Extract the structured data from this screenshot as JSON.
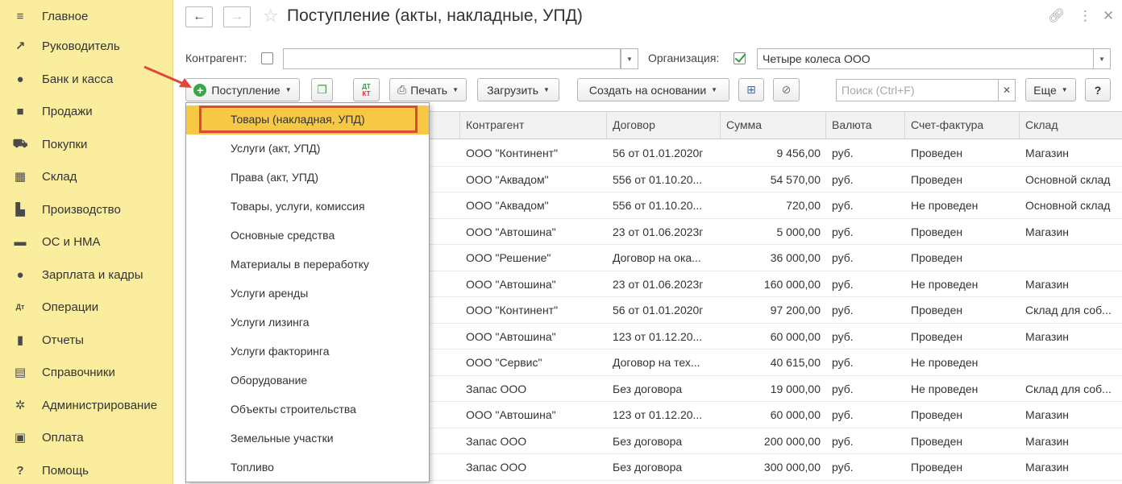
{
  "sidebar": {
    "items": [
      {
        "label": "Главное",
        "icon": "menu-icon"
      },
      {
        "label": "Руководитель",
        "icon": "trend-icon"
      },
      {
        "label": "Банк и касса",
        "icon": "coin-icon"
      },
      {
        "label": "Продажи",
        "icon": "bag-icon"
      },
      {
        "label": "Покупки",
        "icon": "cart-icon"
      },
      {
        "label": "Склад",
        "icon": "warehouse-icon"
      },
      {
        "label": "Производство",
        "icon": "factory-icon"
      },
      {
        "label": "ОС и НМА",
        "icon": "truck-icon"
      },
      {
        "label": "Зарплата и кадры",
        "icon": "person-icon"
      },
      {
        "label": "Операции",
        "icon": "dt-kt-icon"
      },
      {
        "label": "Отчеты",
        "icon": "bar-chart-icon"
      },
      {
        "label": "Справочники",
        "icon": "books-icon"
      },
      {
        "label": "Администрирование",
        "icon": "gear-icon"
      },
      {
        "label": "Оплата",
        "icon": "wallet-icon"
      },
      {
        "label": "Помощь",
        "icon": "question-icon"
      }
    ]
  },
  "header": {
    "title": "Поступление (акты, накладные, УПД)"
  },
  "filters": {
    "counterparty_label": "Контрагент:",
    "counterparty_value": "",
    "organization_label": "Организация:",
    "organization_value": "Четыре колеса ООО"
  },
  "toolbar": {
    "receipt_label": "Поступление",
    "print_label": "Печать",
    "load_label": "Загрузить",
    "create_based_label": "Создать на основании",
    "search_placeholder": "Поиск (Ctrl+F)",
    "more_label": "Еще",
    "help_label": "?",
    "dtkt_top": "ДТ",
    "dtkt_bottom": "КТ"
  },
  "menu": {
    "items": [
      "Товары (накладная, УПД)",
      "Услуги (акт, УПД)",
      "Права (акт, УПД)",
      "Товары, услуги, комиссия",
      "Основные средства",
      "Материалы в переработку",
      "Услуги аренды",
      "Услуги лизинга",
      "Услуги факторинга",
      "Оборудование",
      "Объекты строительства",
      "Земельные участки",
      "Топливо"
    ],
    "selected_index": 0
  },
  "table": {
    "columns": [
      "Контрагент",
      "Договор",
      "Сумма",
      "Валюта",
      "Счет-фактура",
      "Склад"
    ],
    "rows": [
      [
        "ООО \"Континент\"",
        "56 от 01.01.2020г",
        "9 456,00",
        "руб.",
        "Проведен",
        "Магазин"
      ],
      [
        "ООО \"Аквадом\"",
        "556 от 01.10.20...",
        "54 570,00",
        "руб.",
        "Проведен",
        "Основной склад"
      ],
      [
        "ООО \"Аквадом\"",
        "556 от 01.10.20...",
        "720,00",
        "руб.",
        "Не проведен",
        "Основной склад"
      ],
      [
        "ООО \"Автошина\"",
        "23 от 01.06.2023г",
        "5 000,00",
        "руб.",
        "Проведен",
        "Магазин"
      ],
      [
        "ООО \"Решение\"",
        "Договор на ока...",
        "36 000,00",
        "руб.",
        "Проведен",
        ""
      ],
      [
        "ООО \"Автошина\"",
        "23 от 01.06.2023г",
        "160 000,00",
        "руб.",
        "Не проведен",
        "Магазин"
      ],
      [
        "ООО \"Континент\"",
        "56 от 01.01.2020г",
        "97 200,00",
        "руб.",
        "Проведен",
        "Склад для соб..."
      ],
      [
        "ООО \"Автошина\"",
        "123 от 01.12.20...",
        "60 000,00",
        "руб.",
        "Проведен",
        "Магазин"
      ],
      [
        "ООО \"Сервис\"",
        "Договор на тех...",
        "40 615,00",
        "руб.",
        "Не проведен",
        ""
      ],
      [
        "Запас ООО",
        "Без договора",
        "19 000,00",
        "руб.",
        "Не проведен",
        "Склад для соб..."
      ],
      [
        "ООО \"Автошина\"",
        "123 от 01.12.20...",
        "60 000,00",
        "руб.",
        "Проведен",
        "Магазин"
      ],
      [
        "Запас ООО",
        "Без договора",
        "200 000,00",
        "руб.",
        "Проведен",
        "Магазин"
      ],
      [
        "Запас ООО",
        "Без договора",
        "300 000,00",
        "руб.",
        "Проведен",
        "Магазин"
      ]
    ]
  },
  "colors": {
    "sidebar_bg": "#fbed9e",
    "menu_selected": "#f7c844",
    "highlight_border": "#e0463a",
    "accent_green": "#3aa648"
  }
}
